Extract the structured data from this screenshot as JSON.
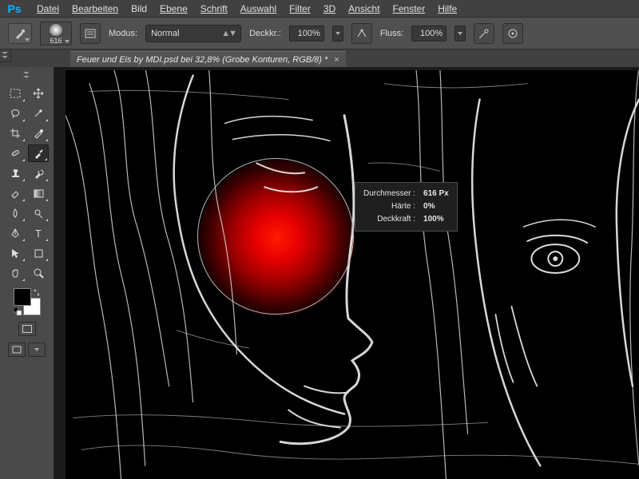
{
  "app": {
    "short": "Ps"
  },
  "menu": [
    "Datei",
    "Bearbeiten",
    "Bild",
    "Ebene",
    "Schrift",
    "Auswahl",
    "Filter",
    "3D",
    "Ansicht",
    "Fenster",
    "Hilfe"
  ],
  "options": {
    "brush_size": "616",
    "mode_label": "Modus:",
    "mode_value": "Normal",
    "opacity_label": "Deckkr.:",
    "opacity_value": "100%",
    "flow_label": "Fluss:",
    "flow_value": "100%"
  },
  "tab": {
    "title": "Feuer und Eis by MDI.psd bei 32,8% (Grobe Konturen, RGB/8) *",
    "close": "×"
  },
  "tooltip": {
    "diameter_label": "Durchmesser :",
    "diameter_value": "616 Px",
    "hardness_label": "Härte :",
    "hardness_value": "0%",
    "opacity_label": "Deckkraft :",
    "opacity_value": "100%"
  },
  "tools": [
    "move",
    "marquee",
    "lasso",
    "magic-wand",
    "crop",
    "eyedropper",
    "healing",
    "brush",
    "stamp",
    "history-brush",
    "eraser",
    "gradient",
    "blur",
    "dodge",
    "pen",
    "type",
    "path-select",
    "shape",
    "hand",
    "zoom"
  ],
  "colors": {
    "fg": "#000000",
    "bg": "#ffffff"
  }
}
